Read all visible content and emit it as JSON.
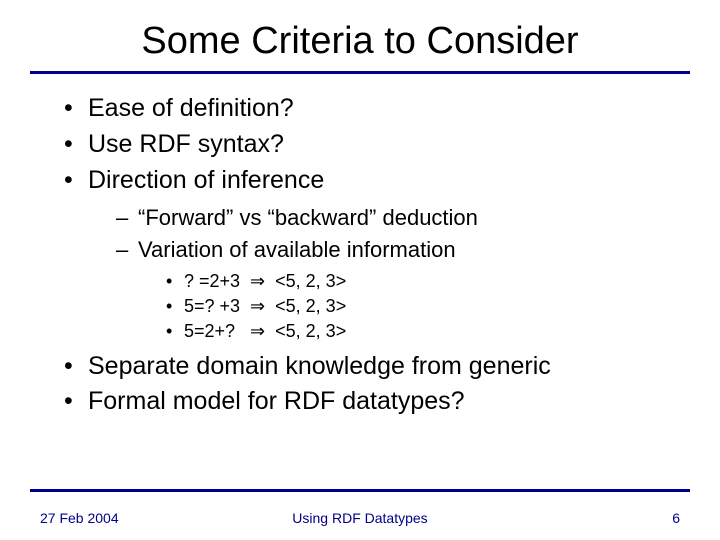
{
  "title": "Some Criteria to Consider",
  "bullets": {
    "b1": "Ease of definition?",
    "b2": "Use RDF syntax?",
    "b3": "Direction of inference",
    "b3_sub": {
      "s1": "“Forward” vs “backward” deduction",
      "s2": "Variation of available information",
      "s2_sub": {
        "e1": "? =2+3  ⇒  <5, 2, 3>",
        "e2": "5=? +3  ⇒  <5, 2, 3>",
        "e3": "5=2+?   ⇒  <5, 2, 3>"
      }
    },
    "b4": "Separate domain knowledge from generic",
    "b5": "Formal model for RDF datatypes?"
  },
  "footer": {
    "date": "27 Feb 2004",
    "center": "Using RDF Datatypes",
    "page": "6"
  }
}
